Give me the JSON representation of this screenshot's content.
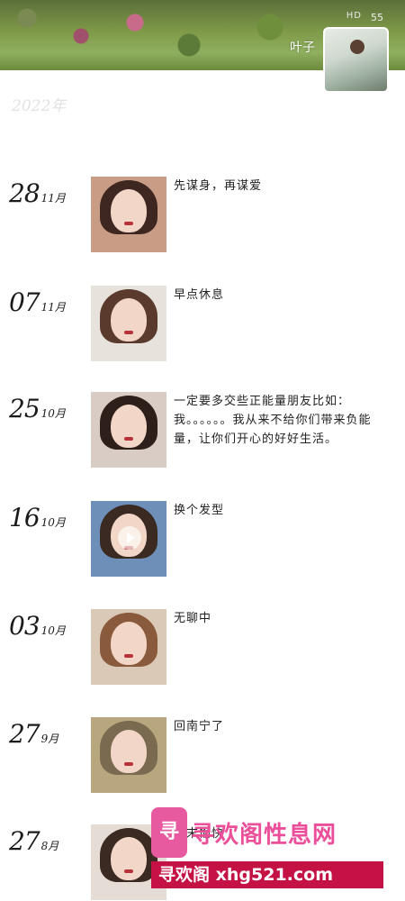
{
  "status_bar": {
    "icons": "HD",
    "time": "55"
  },
  "profile": {
    "username": "叶子"
  },
  "year": "2022年",
  "posts": [
    {
      "day": "28",
      "month": "11月",
      "text": "先谋身，再谋爱",
      "thumb": {
        "hair": "#3d2720",
        "bg": "#c99c86"
      }
    },
    {
      "day": "07",
      "month": "11月",
      "text": "早点休息",
      "thumb": {
        "hair": "#5a3a2c",
        "bg": "#e8e2dc"
      }
    },
    {
      "day": "25",
      "month": "10月",
      "text": "一定要多交些正能量朋友比如：我。。。。。。我从来不给你们带来负能量，让你们开心的好好生活。",
      "thumb": {
        "hair": "#2e1f1a",
        "bg": "#d8ccc4"
      }
    },
    {
      "day": "16",
      "month": "10月",
      "text": "换个发型",
      "thumb": {
        "hair": "#3a2a22",
        "bg": "#6e8fb8"
      },
      "video": true
    },
    {
      "day": "03",
      "month": "10月",
      "text": "无聊中",
      "thumb": {
        "hair": "#8a5a3c",
        "bg": "#d9c9b6"
      }
    },
    {
      "day": "27",
      "month": "9月",
      "text": "回南宁了",
      "thumb": {
        "hair": "#7a6a50",
        "bg": "#b8a77e"
      }
    },
    {
      "day": "27",
      "month": "8月",
      "text": "周末愉快",
      "thumb": {
        "hair": "#3a2a22",
        "bg": "#e6dcd6"
      }
    }
  ],
  "watermark": {
    "logo": "寻",
    "title": "寻欢阁性息网",
    "banner": "寻欢阁 xhg521.com"
  }
}
